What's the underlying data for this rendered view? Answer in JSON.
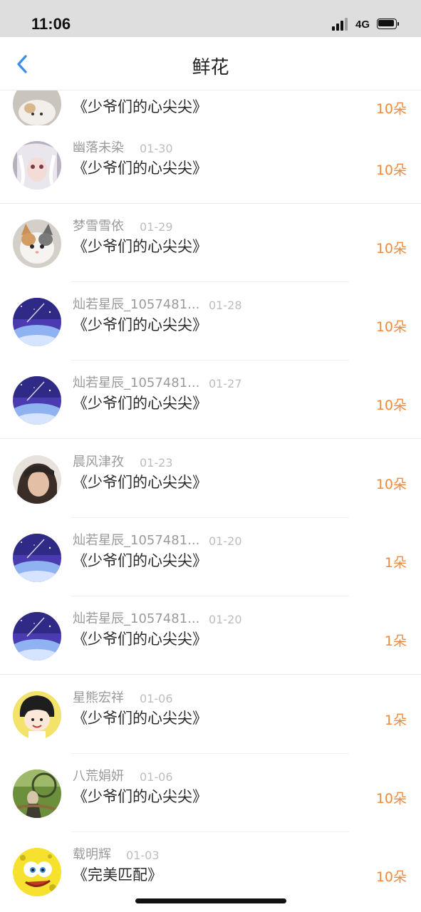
{
  "status_bar": {
    "time": "11:06",
    "network": "4G",
    "icons": [
      "signal-icon",
      "battery-icon"
    ]
  },
  "header": {
    "title": "鲜花",
    "back_icon": "chevron-left-icon"
  },
  "colors": {
    "accent_orange": "#f08a3c",
    "back_blue": "#3a8ee6",
    "name_gray": "#9a9a9a",
    "date_gray": "#bdbdbd"
  },
  "gifts": [
    {
      "name": "",
      "date": "",
      "book": "《少爷们的心尖尖》",
      "count": "10朵",
      "avatar": "cat-avatar"
    },
    {
      "name": "幽落未染",
      "date": "01-30",
      "book": "《少爷们的心尖尖》",
      "count": "10朵",
      "avatar": "anime-girl-avatar"
    },
    {
      "name": "梦雪雪依",
      "date": "01-29",
      "book": "《少爷们的心尖尖》",
      "count": "10朵",
      "avatar": "kitten-avatar"
    },
    {
      "name": "灿若星辰_1057481...",
      "date": "01-28",
      "book": "《少爷们的心尖尖》",
      "count": "10朵",
      "avatar": "starry-sky-avatar"
    },
    {
      "name": "灿若星辰_1057481...",
      "date": "01-27",
      "book": "《少爷们的心尖尖》",
      "count": "10朵",
      "avatar": "starry-sky-avatar"
    },
    {
      "name": "晨风津孜",
      "date": "01-23",
      "book": "《少爷们的心尖尖》",
      "count": "10朵",
      "avatar": "portrait-avatar"
    },
    {
      "name": "灿若星辰_1057481...",
      "date": "01-20",
      "book": "《少爷们的心尖尖》",
      "count": "1朵",
      "avatar": "starry-sky-avatar"
    },
    {
      "name": "灿若星辰_1057481...",
      "date": "01-20",
      "book": "《少爷们的心尖尖》",
      "count": "1朵",
      "avatar": "starry-sky-avatar"
    },
    {
      "name": "星熊宏祥",
      "date": "01-06",
      "book": "《少爷们的心尖尖》",
      "count": "1朵",
      "avatar": "cartoon-girl-avatar"
    },
    {
      "name": "八荒娟妍",
      "date": "01-06",
      "book": "《少爷们的心尖尖》",
      "count": "10朵",
      "avatar": "outdoor-photo-avatar"
    },
    {
      "name": "载明辉",
      "date": "01-03",
      "book": "《完美匹配》",
      "count": "10朵",
      "avatar": "sponge-avatar"
    }
  ]
}
